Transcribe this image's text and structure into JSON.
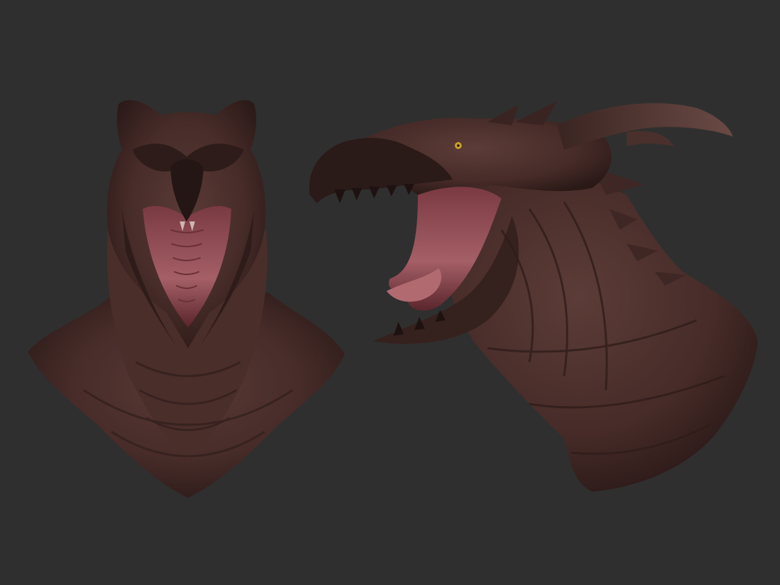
{
  "scene": {
    "background_color": "#2f2f2f",
    "subject": "dragon-bust-sculpt",
    "views": [
      {
        "id": "front",
        "label": ""
      },
      {
        "id": "side",
        "label": ""
      }
    ],
    "colors": {
      "skin_dark": "#2a1a18",
      "skin_mid": "#4a2e2b",
      "skin_light": "#6b4640",
      "mouth": "#a05a62",
      "mouth_dark": "#5e2a30",
      "teeth": "#d8c8c0",
      "eye": "#c8a020"
    }
  }
}
